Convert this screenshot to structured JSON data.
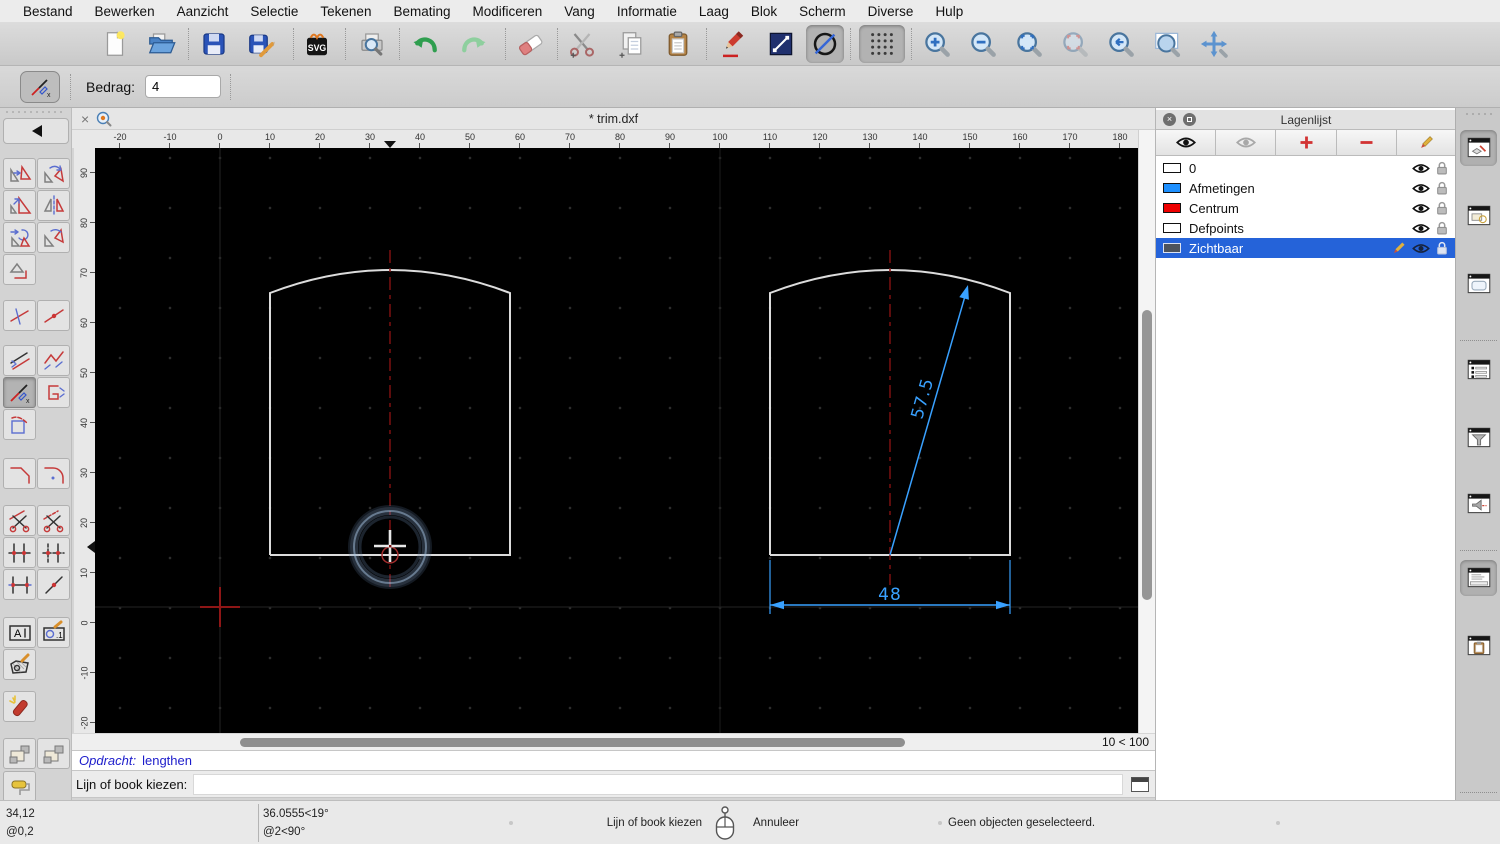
{
  "menubar": {
    "items": [
      "Bestand",
      "Bewerken",
      "Aanzicht",
      "Selectie",
      "Tekenen",
      "Bemating",
      "Modificeren",
      "Vang",
      "Informatie",
      "Laag",
      "Blok",
      "Scherm",
      "Diverse",
      "Hulp"
    ]
  },
  "toolbar": {
    "tool_names": [
      "new-file",
      "open-file",
      "save",
      "save-as",
      "export-svg",
      "print-preview",
      "undo",
      "redo",
      "erase",
      "cut",
      "copy",
      "paste",
      "draw-pencil",
      "draw-line",
      "draft-mode-toggle",
      "grid-toggle",
      "zoom-in",
      "zoom-out",
      "zoom-auto",
      "zoom-selection",
      "zoom-previous",
      "zoom-window",
      "pan"
    ]
  },
  "options_toolbar": {
    "tool": "lengthen",
    "amount_label": "Bedrag:",
    "amount_value": "4"
  },
  "tab": {
    "title": "* trim.dxf",
    "close_glyph": "×"
  },
  "rulers": {
    "horizontal": [
      "-20",
      "-10",
      "0",
      "10",
      "20",
      "30",
      "40",
      "50",
      "60",
      "70",
      "80",
      "90",
      "100",
      "110",
      "120",
      "130",
      "140",
      "150",
      "160",
      "170",
      "180"
    ],
    "vertical": [
      "90",
      "80",
      "70",
      "60",
      "50",
      "40",
      "30",
      "20",
      "10",
      "0",
      "-10",
      "-20"
    ]
  },
  "drawing": {
    "dimension_diagonal": "57.5",
    "dimension_width": "48",
    "zoom_indicator": "10 < 100"
  },
  "layer_panel": {
    "title": "Lagenlijst",
    "layers": [
      {
        "name": "0",
        "color": "#ffffff",
        "selected": false
      },
      {
        "name": "Afmetingen",
        "color": "#1e90ff",
        "selected": false
      },
      {
        "name": "Centrum",
        "color": "#ee0000",
        "selected": false
      },
      {
        "name": "Defpoints",
        "color": "#ffffff",
        "selected": false
      },
      {
        "name": "Zichtbaar",
        "color": "#4d535c",
        "selected": true
      }
    ]
  },
  "dock": {
    "button_names": [
      "layer-list",
      "block-list",
      "view-list",
      "property-editor",
      "selection-filter",
      "library-browser",
      "command-line",
      "clipboard"
    ]
  },
  "palette": {
    "tool_names": [
      "back",
      "move",
      "rotate",
      "scale",
      "mirror",
      "move-rotate",
      "rotate-two",
      "project",
      "trim",
      "lengthen-shorten",
      "trim-two",
      "multi-trim",
      "lengthen",
      "polyline-edit",
      "auto-trim",
      "bevel",
      "fillet",
      "cut-at-point",
      "cut-segment",
      "break",
      "break-manual",
      "stretch",
      "divide",
      "text-edit",
      "dimension-edit",
      "hatch-edit",
      "explode",
      "order-front",
      "order-back",
      "paint"
    ]
  },
  "command": {
    "history_prefix": "Opdracht:",
    "history_command": "lengthen",
    "prompt": "Lijn of book kiezen:",
    "input_value": ""
  },
  "statusbar": {
    "coord_abs": "34,12",
    "coord_rel": "@0,2",
    "polar_abs": "36.0555<19°",
    "polar_rel": "@2<90°",
    "left_click": "Lijn of book kiezen",
    "right_click": "Annuleer",
    "selection": "Geen objecten geselecteerd."
  },
  "icons": {
    "svg_badge": "SVG",
    "text_edit_badge": "A",
    "dim_edit_badge": ".1"
  },
  "colors": {
    "dimension_blue": "#39a1ff",
    "centerline_red": "#7c1111",
    "selection_blue": "#2563d9"
  }
}
